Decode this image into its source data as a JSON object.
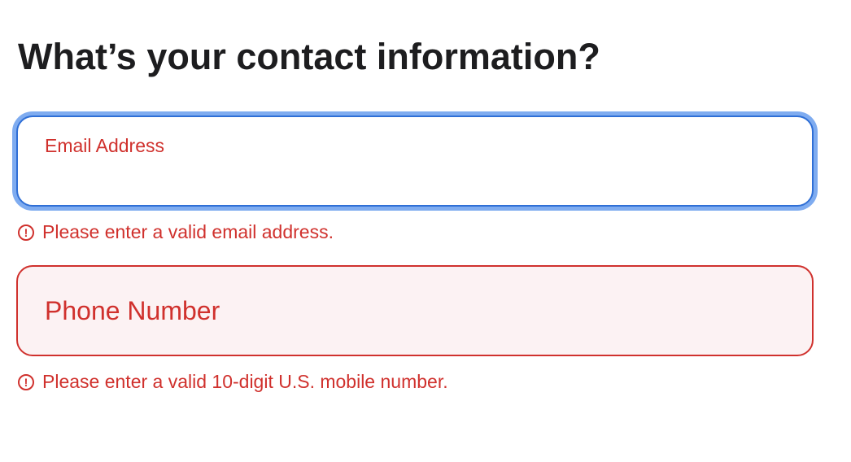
{
  "page": {
    "heading": "What’s your contact information?"
  },
  "email_field": {
    "label": "Email Address",
    "value": "",
    "error": "Please enter a valid email address.",
    "state": "focused-invalid"
  },
  "phone_field": {
    "label": "Phone Number",
    "value": "",
    "error": "Please enter a valid 10-digit U.S. mobile number.",
    "state": "invalid"
  },
  "icons": {
    "error_icon": "exclamation-circle-icon",
    "error_glyph": "!"
  },
  "colors": {
    "error": "#d0312d",
    "focus_border": "#2f6fd6",
    "focus_ring": "#7facf0",
    "invalid_background": "#fcf2f3",
    "heading": "#1d1d1f"
  }
}
